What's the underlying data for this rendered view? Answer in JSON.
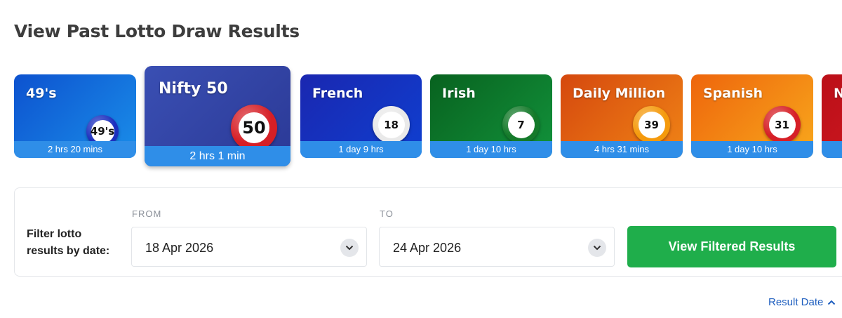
{
  "page_title": "View Past Lotto Draw Results",
  "games": [
    {
      "name": "49's",
      "countdown": "2 hrs 20 mins",
      "ball_label": "49's",
      "ball_color": "#1b2fbf",
      "bg": [
        "#0f5bd6",
        "#1488e6"
      ]
    },
    {
      "name": "Nifty 50",
      "countdown": "2 hrs 1 min",
      "ball_label": "50",
      "ball_color": "#d61f26",
      "bg": [
        "#3447a8",
        "#2f3e9a"
      ]
    },
    {
      "name": "French",
      "countdown": "1 day 9 hrs",
      "ball_label": "18",
      "ball_color": "#e9e9e9",
      "bg": [
        "#1a2bb8",
        "#1037c7"
      ]
    },
    {
      "name": "Irish",
      "countdown": "1 day 10 hrs",
      "ball_label": "7",
      "ball_color": "#147a2a",
      "bg": [
        "#0a6a25",
        "#0e8a36"
      ]
    },
    {
      "name": "Daily Million",
      "countdown": "4 hrs 31 mins",
      "ball_label": "39",
      "ball_color": "#f59a0c",
      "bg": [
        "#d94f0e",
        "#ee7a14"
      ]
    },
    {
      "name": "Spanish",
      "countdown": "1 day 10 hrs",
      "ball_label": "31",
      "ball_color": "#d61f26",
      "bg": [
        "#ef6a0c",
        "#f7a11a"
      ]
    },
    {
      "name": "N",
      "countdown": "",
      "ball_label": "",
      "ball_color": "#c0101a",
      "bg": [
        "#c0101a",
        "#d11a22"
      ]
    }
  ],
  "filter": {
    "label_line1": "Filter lotto",
    "label_line2": "results by date:",
    "from_caption": "FROM",
    "from_value": "18 Apr 2026",
    "to_caption": "TO",
    "to_value": "24 Apr 2026",
    "submit_label": "View Filtered Results"
  },
  "sort": {
    "label": "Result Date"
  },
  "colors": {
    "accent_blue": "#2f8ee8",
    "submit_green": "#1fae4b",
    "link_blue": "#1f5fbf"
  }
}
